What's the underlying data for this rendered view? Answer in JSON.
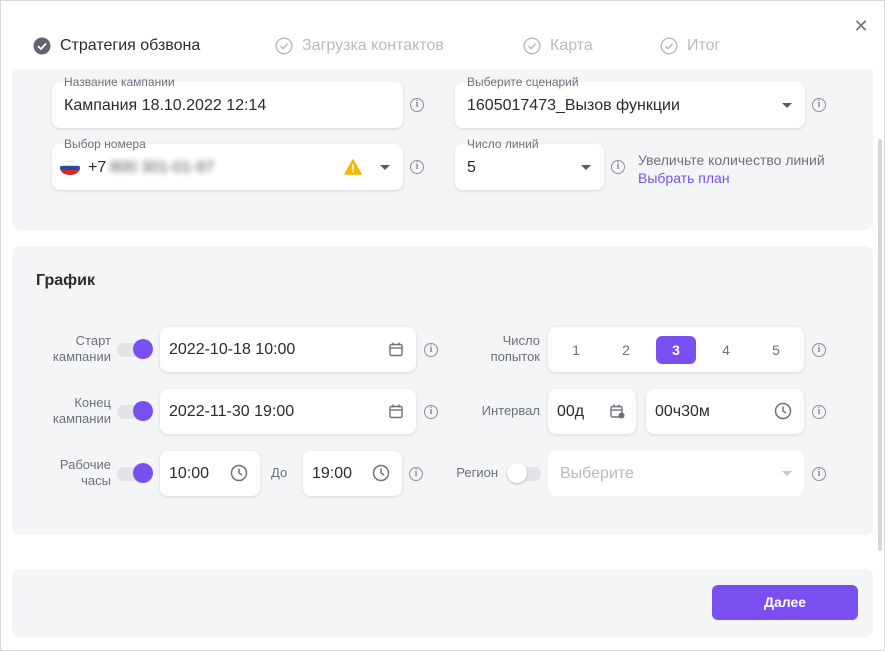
{
  "steps": [
    {
      "label": "Стратегия обзвона"
    },
    {
      "label": "Загрузка контактов"
    },
    {
      "label": "Карта"
    },
    {
      "label": "Итог"
    }
  ],
  "campaign": {
    "name_label": "Название кампании",
    "name_value": "Кампания 18.10.2022 12:14",
    "scenario_label": "Выберите сценарий",
    "scenario_value": "1605017473_Вызов функции",
    "number_label": "Выбор номера",
    "number_prefix": "+7",
    "number_value": "800 301-01-97",
    "lines_label": "Число линий",
    "lines_value": "5",
    "lines_hint": "Увеличьте количество линий",
    "plan_link": "Выбрать план"
  },
  "schedule": {
    "title": "График",
    "start_label_1": "Старт",
    "start_label_2": "кампании",
    "start_value": "2022-10-18 10:00",
    "end_label_1": "Конец",
    "end_label_2": "кампании",
    "end_value": "2022-11-30 19:00",
    "hours_label_1": "Рабочие",
    "hours_label_2": "часы",
    "hours_from": "10:00",
    "to_label": "До",
    "hours_to": "19:00",
    "attempts_label_1": "Число",
    "attempts_label_2": "попыток",
    "attempts": [
      "1",
      "2",
      "3",
      "4",
      "5"
    ],
    "attempts_selected": "3",
    "interval_label": "Интервал",
    "interval_days": "00д",
    "interval_time": "00ч30м",
    "region_label": "Регион",
    "region_placeholder": "Выберите"
  },
  "footer": {
    "next_label": "Далее"
  },
  "colors": {
    "accent": "#7a4ff0",
    "warning": "#f5b800",
    "section_bg": "#f4f5f7"
  }
}
